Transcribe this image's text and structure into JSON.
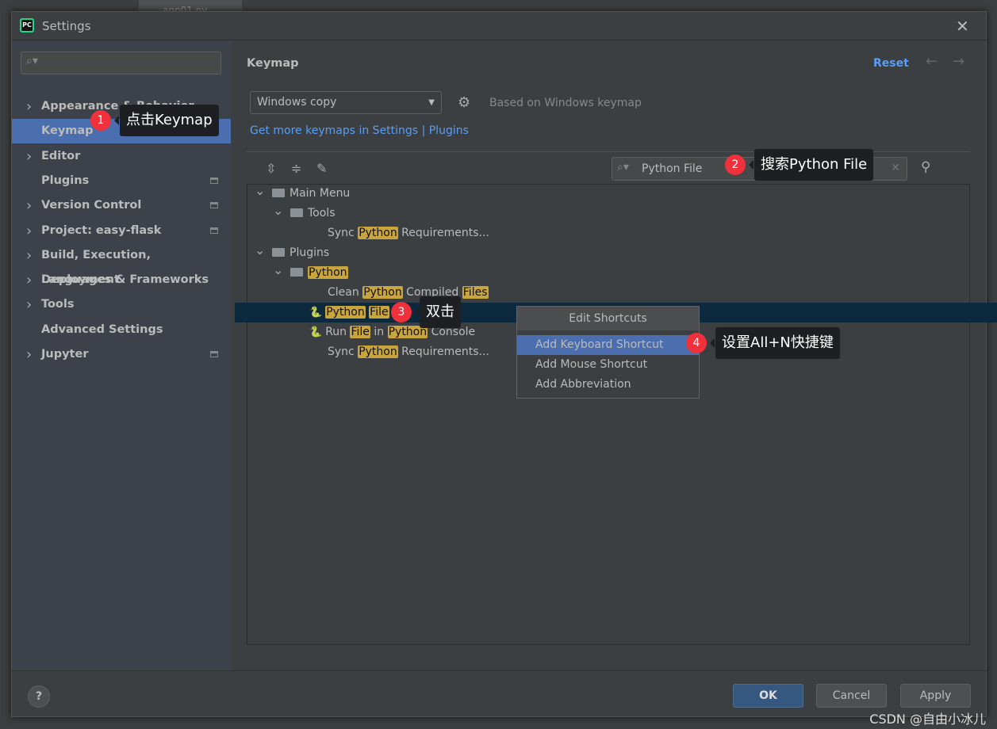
{
  "ide": {
    "tab_label": "app01.py"
  },
  "dialog": {
    "title": "Settings",
    "app_icon": "PC",
    "close": "✕"
  },
  "sidebar": {
    "search_placeholder": "",
    "items": [
      {
        "label": "Appearance & Behavior",
        "chevron": true
      },
      {
        "label": "Keymap",
        "selected": true
      },
      {
        "label": "Editor",
        "chevron": true
      },
      {
        "label": "Plugins",
        "badge": true
      },
      {
        "label": "Version Control",
        "chevron": true,
        "badge": true
      },
      {
        "label": "Project: easy-flask",
        "chevron": true,
        "badge": true
      },
      {
        "label": "Build, Execution, Deployment",
        "chevron": true
      },
      {
        "label": "Languages & Frameworks",
        "chevron": true
      },
      {
        "label": "Tools",
        "chevron": true
      },
      {
        "label": "Advanced Settings"
      },
      {
        "label": "Jupyter",
        "chevron": true,
        "badge": true
      }
    ]
  },
  "main": {
    "title": "Keymap",
    "reset": "Reset",
    "keymap_select": "Windows copy",
    "based_on": "Based on Windows keymap",
    "link_more": "Get more keymaps in Settings",
    "link_sep": "|",
    "link_plugins": "Plugins",
    "search_value": "Python File",
    "tree": [
      {
        "parts": [
          [
            "Main Menu",
            false
          ]
        ],
        "indent": 0,
        "icon": "menu-folder",
        "expanded": true
      },
      {
        "parts": [
          [
            "Tools",
            false
          ]
        ],
        "indent": 1,
        "icon": "folder",
        "expanded": true
      },
      {
        "parts": [
          [
            "Sync ",
            false
          ],
          [
            "Python",
            true
          ],
          [
            " Requirements...",
            false
          ]
        ],
        "indent": 2
      },
      {
        "parts": [
          [
            "Plugins",
            false
          ]
        ],
        "indent": 0,
        "icon": "folder",
        "expanded": true
      },
      {
        "parts": [
          [
            "Python",
            true
          ]
        ],
        "indent": 1,
        "icon": "folder",
        "expanded": true
      },
      {
        "parts": [
          [
            "Clean ",
            false
          ],
          [
            "Python",
            true
          ],
          [
            " Compiled ",
            false
          ],
          [
            "Files",
            true
          ]
        ],
        "indent": 2
      },
      {
        "parts": [
          [
            "Python",
            true
          ],
          [
            " ",
            false
          ],
          [
            "File",
            true
          ]
        ],
        "indent": 2,
        "icon": "python-file",
        "selected": true
      },
      {
        "parts": [
          [
            "Run ",
            false
          ],
          [
            "File",
            true
          ],
          [
            " in ",
            false
          ],
          [
            "Python",
            true
          ],
          [
            " Console",
            false
          ]
        ],
        "indent": 2,
        "icon": "python"
      },
      {
        "parts": [
          [
            "Sync ",
            false
          ],
          [
            "Python",
            true
          ],
          [
            " Requirements...",
            false
          ]
        ],
        "indent": 2
      }
    ]
  },
  "popup": {
    "header": "Edit Shortcuts",
    "items": [
      "Add Keyboard Shortcut",
      "Add Mouse Shortcut",
      "Add Abbreviation"
    ]
  },
  "footer": {
    "help": "?",
    "ok": "OK",
    "cancel": "Cancel",
    "apply": "Apply"
  },
  "annotations": [
    {
      "num": "1",
      "text": "点击Keymap"
    },
    {
      "num": "2",
      "text": "搜索Python File"
    },
    {
      "num": "3",
      "text": "双击"
    },
    {
      "num": "4",
      "text": "设置All+N快捷键"
    }
  ],
  "watermark": "CSDN @自由小冰儿",
  "colors": {
    "accent": "#4b6eaf",
    "link": "#589df6",
    "highlight": "#c9a53e",
    "badge": "#f0303a"
  }
}
